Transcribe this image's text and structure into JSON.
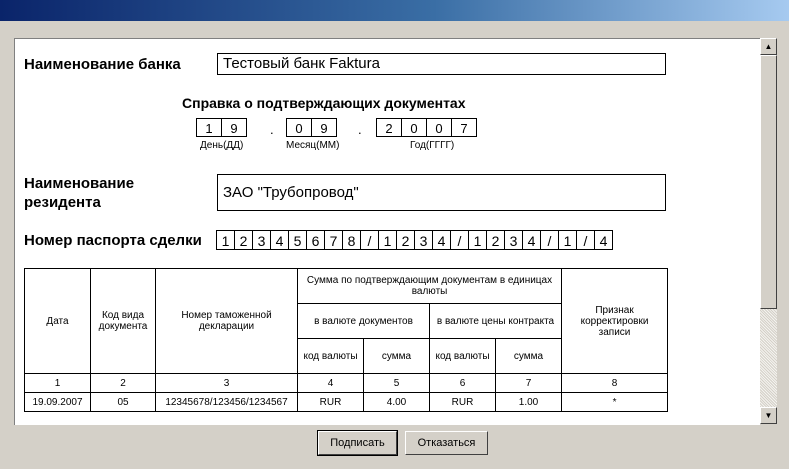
{
  "form": {
    "bank_label": "Наименование банка",
    "bank_value": "Тестовый банк Faktura",
    "heading": "Справка о подтверждающих документах",
    "date": {
      "day": [
        "1",
        "9"
      ],
      "month": [
        "0",
        "9"
      ],
      "year": [
        "2",
        "0",
        "0",
        "7"
      ],
      "day_label": "День(ДД)",
      "month_label": "Месяц(ММ)",
      "year_label": "Год(ГГГГ)",
      "separator": "."
    },
    "resident_label_line1": "Наименование",
    "resident_label_line2": "резидента",
    "resident_value": "ЗАО \"Трубопровод\"",
    "passport_label": "Номер паспорта сделки",
    "passport_chars": [
      "1",
      "2",
      "3",
      "4",
      "5",
      "6",
      "7",
      "8",
      "/",
      "1",
      "2",
      "3",
      "4",
      "/",
      "1",
      "2",
      "3",
      "4",
      "/",
      "1",
      "/",
      "4"
    ]
  },
  "table": {
    "h_date": "Дата",
    "h_doc_type": "Код вида документа",
    "h_customs": "Номер таможенной декларации",
    "h_sum": "Сумма по подтверждающим документам в единицах валюты",
    "h_doc_currency": "в валюте документов",
    "h_contract_currency": "в валюте цены контракта",
    "h_code1": "код валюты",
    "h_amount1": "сумма",
    "h_code2": "код валюты",
    "h_amount2": "сумма",
    "h_flag": "Признак корректировки записи",
    "col_numbers": [
      "1",
      "2",
      "3",
      "4",
      "5",
      "6",
      "7",
      "8"
    ],
    "rows": [
      [
        "19.09.2007",
        "05",
        "12345678/123456/1234567",
        "RUR",
        "4.00",
        "RUR",
        "1.00",
        "*"
      ]
    ]
  },
  "buttons": {
    "sign": "Подписать",
    "cancel": "Отказаться"
  },
  "scrollbar": {
    "up_icon": "▲",
    "down_icon": "▼"
  }
}
